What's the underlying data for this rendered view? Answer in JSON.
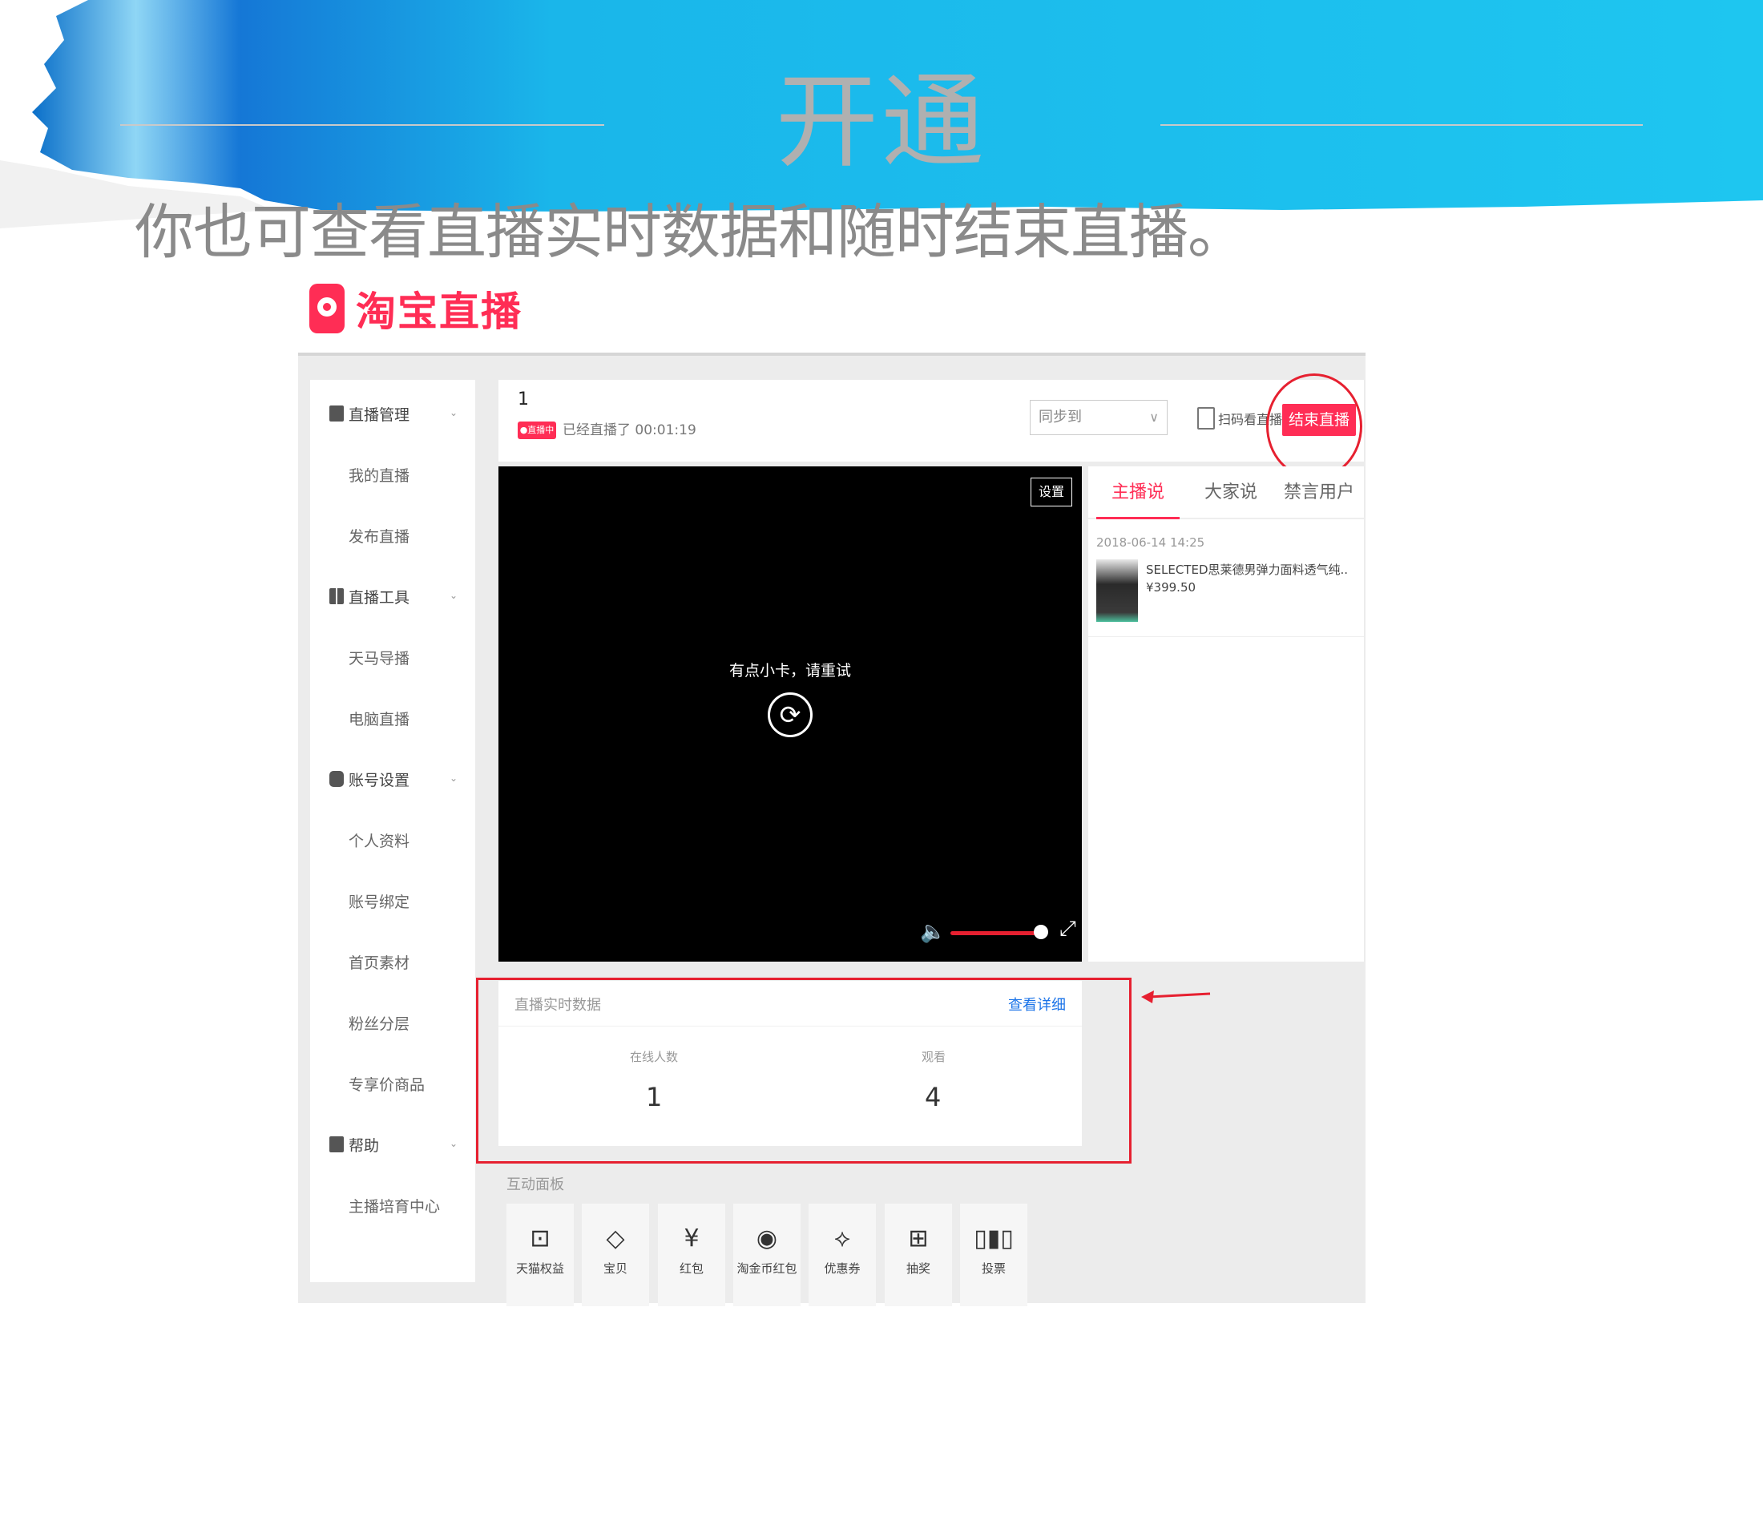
{
  "slide": {
    "title": "开通",
    "subtitle": "你也可查看直播实时数据和随时结束直播。",
    "logo_text": "淘宝直播"
  },
  "colors": {
    "banner": "#1ec4ef",
    "accent": "#ff2d55",
    "highlight": "#e62030",
    "link": "#1a73e8"
  },
  "sidebar": {
    "groups": [
      {
        "label": "直播管理",
        "icon": "document-icon"
      },
      {
        "label": "直播工具",
        "icon": "grid-icon"
      },
      {
        "label": "账号设置",
        "icon": "account-icon"
      },
      {
        "label": "帮助",
        "icon": "book-icon"
      }
    ],
    "items": {
      "my_live": "我的直播",
      "publish_live": "发布直播",
      "tianma": "天马导播",
      "pc_live": "电脑直播",
      "profile": "个人资料",
      "binding": "账号绑定",
      "home_material": "首页素材",
      "fan_layers": "粉丝分层",
      "exclusive_goods": "专享价商品",
      "training": "主播培育中心"
    }
  },
  "topbar": {
    "stream_name": "1",
    "live_badge": "●直播中",
    "live_time": "已经直播了 00:01:19",
    "sync_placeholder": "同步到",
    "scan_label": "扫码看直播",
    "end_label": "结束直播"
  },
  "video": {
    "settings_label": "设置",
    "error_text": "有点小卡，请重试",
    "volume_level": 0.9
  },
  "rpanel": {
    "tabs": [
      "主播说",
      "大家说",
      "禁言用户"
    ],
    "comment_time": "2018-06-14 14:25",
    "product_name": "SELECTED思莱德男弹力面料透气纯..",
    "product_price": "¥399.50"
  },
  "realtime": {
    "title": "直播实时数据",
    "more_label": "查看详细",
    "online_label": "在线人数",
    "online_value": "1",
    "views_label": "观看",
    "views_value": "4"
  },
  "interaction": {
    "title": "互动面板",
    "tools": [
      {
        "label": "天猫权益",
        "icon": "tmall-icon"
      },
      {
        "label": "宝贝",
        "icon": "tag-icon"
      },
      {
        "label": "红包",
        "icon": "red-packet-icon"
      },
      {
        "label": "淘金币红包",
        "icon": "coin-icon"
      },
      {
        "label": "优惠券",
        "icon": "coupon-icon"
      },
      {
        "label": "抽奖",
        "icon": "gift-icon"
      },
      {
        "label": "投票",
        "icon": "vote-icon"
      }
    ]
  }
}
